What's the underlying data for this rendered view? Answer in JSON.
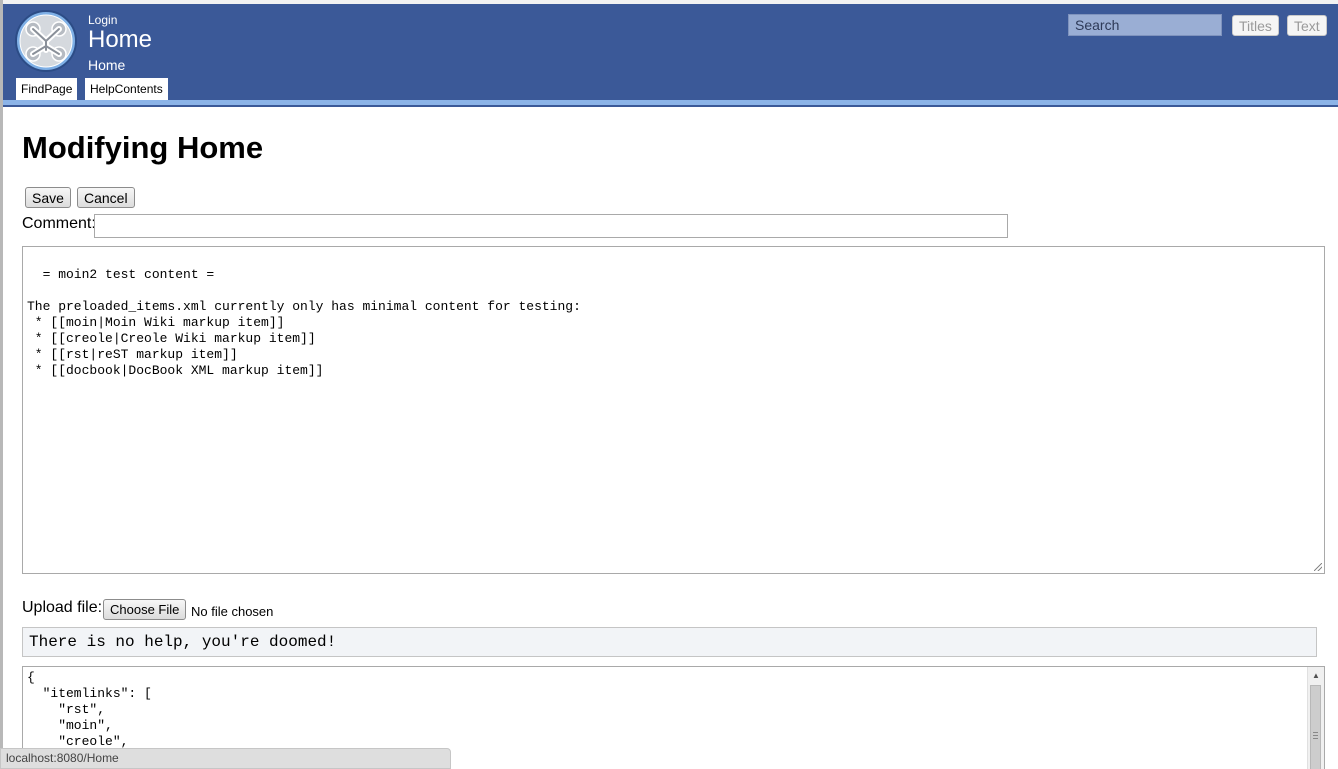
{
  "header": {
    "login_label": "Login",
    "site_title": "Home",
    "breadcrumb": "Home",
    "nav_tabs": [
      "FindPage",
      "HelpContents"
    ],
    "search": {
      "placeholder": "Search"
    },
    "titles_button": "Titles",
    "text_button": "Text",
    "logo_icon": "moin-logo-icon",
    "colors": {
      "header_bg": "#3b5998",
      "stripe": "#8cb4e8"
    }
  },
  "main": {
    "heading": "Modifying Home",
    "save_label": "Save",
    "cancel_label": "Cancel",
    "comment_label": "Comment:",
    "comment_value": "",
    "editor_content": "= moin2 test content =\n\nThe preloaded_items.xml currently only has minimal content for testing:\n * [[moin|Moin Wiki markup item]]\n * [[creole|Creole Wiki markup item]]\n * [[rst|reST markup item]]\n * [[docbook|DocBook XML markup item]]",
    "upload_label": "Upload file:",
    "choose_file_label": "Choose File",
    "no_file_label": "No file chosen",
    "help_text": "There is no help, you're doomed!",
    "meta_content": "{\n  \"itemlinks\": [\n    \"rst\",\n    \"moin\",\n    \"creole\","
  },
  "status_bar": {
    "url": "localhost:8080/Home"
  }
}
